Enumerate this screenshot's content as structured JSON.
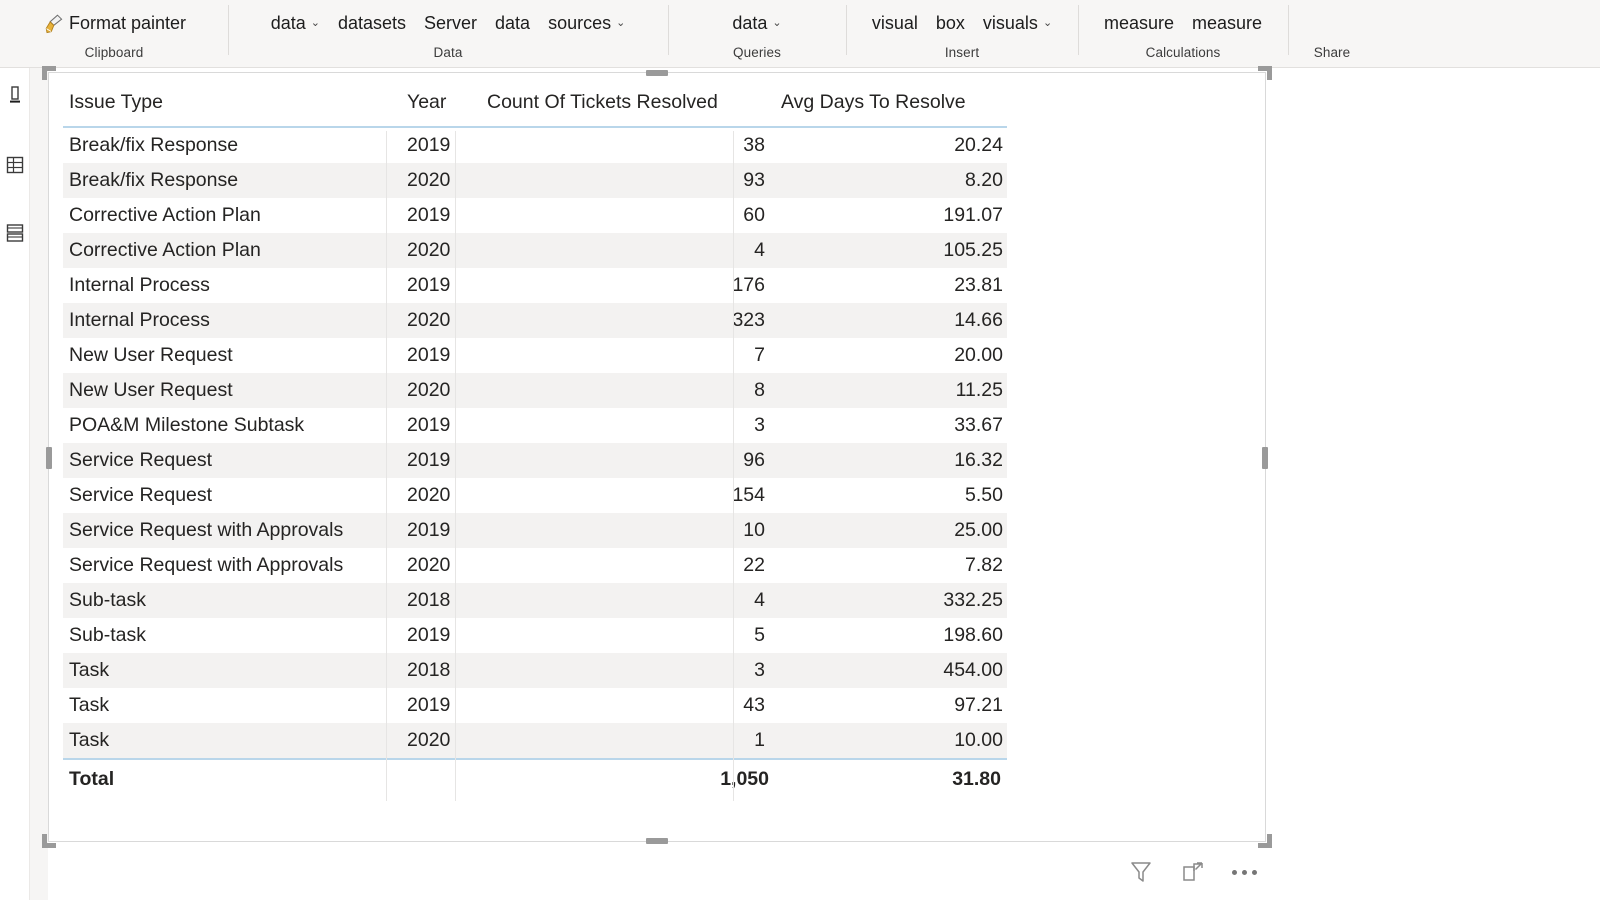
{
  "ribbon": {
    "groups": [
      {
        "name": "clipboard",
        "label": "Clipboard",
        "items": [
          {
            "label": "Format painter",
            "icon": "format-painter-icon",
            "caret": false
          }
        ]
      },
      {
        "name": "data",
        "label": "Data",
        "items": [
          {
            "label": "data",
            "icon": "",
            "caret": true
          },
          {
            "label": "datasets",
            "icon": "",
            "caret": false
          },
          {
            "label": "Server",
            "icon": "",
            "caret": false
          },
          {
            "label": "data",
            "icon": "",
            "caret": false
          },
          {
            "label": "sources",
            "icon": "",
            "caret": true
          }
        ]
      },
      {
        "name": "queries",
        "label": "Queries",
        "items": [
          {
            "label": "data",
            "icon": "",
            "caret": true
          }
        ]
      },
      {
        "name": "insert",
        "label": "Insert",
        "items": [
          {
            "label": "visual",
            "icon": "",
            "caret": false
          },
          {
            "label": "box",
            "icon": "",
            "caret": false
          },
          {
            "label": "visuals",
            "icon": "",
            "caret": true
          }
        ]
      },
      {
        "name": "calculations",
        "label": "Calculations",
        "items": [
          {
            "label": "measure",
            "icon": "",
            "caret": false
          },
          {
            "label": "measure",
            "icon": "",
            "caret": false
          }
        ]
      },
      {
        "name": "share",
        "label": "Share",
        "items": []
      }
    ]
  },
  "left_rail": {
    "items": [
      {
        "name": "report-view-icon"
      },
      {
        "name": "data-view-icon"
      },
      {
        "name": "model-view-icon"
      }
    ]
  },
  "visual_footer": {
    "filter_icon": "filter-icon",
    "focus_icon": "focus-mode-icon",
    "more_label": "more-options-icon"
  },
  "table": {
    "columns": [
      {
        "key": "issue_type",
        "label": "Issue Type",
        "align": "left"
      },
      {
        "key": "year",
        "label": "Year",
        "align": "left"
      },
      {
        "key": "count_resolved",
        "label": "Count Of Tickets Resolved",
        "align": "right"
      },
      {
        "key": "avg_days",
        "label": "Avg Days To Resolve",
        "align": "right"
      }
    ],
    "rows": [
      {
        "issue_type": "Break/fix Response",
        "year": "2019",
        "count_resolved": "38",
        "avg_days": "20.24"
      },
      {
        "issue_type": "Break/fix Response",
        "year": "2020",
        "count_resolved": "93",
        "avg_days": "8.20"
      },
      {
        "issue_type": "Corrective Action Plan",
        "year": "2019",
        "count_resolved": "60",
        "avg_days": "191.07"
      },
      {
        "issue_type": "Corrective Action Plan",
        "year": "2020",
        "count_resolved": "4",
        "avg_days": "105.25"
      },
      {
        "issue_type": "Internal Process",
        "year": "2019",
        "count_resolved": "176",
        "avg_days": "23.81"
      },
      {
        "issue_type": "Internal Process",
        "year": "2020",
        "count_resolved": "323",
        "avg_days": "14.66"
      },
      {
        "issue_type": "New User Request",
        "year": "2019",
        "count_resolved": "7",
        "avg_days": "20.00"
      },
      {
        "issue_type": "New User Request",
        "year": "2020",
        "count_resolved": "8",
        "avg_days": "11.25"
      },
      {
        "issue_type": "POA&M Milestone Subtask",
        "year": "2019",
        "count_resolved": "3",
        "avg_days": "33.67"
      },
      {
        "issue_type": "Service Request",
        "year": "2019",
        "count_resolved": "96",
        "avg_days": "16.32"
      },
      {
        "issue_type": "Service Request",
        "year": "2020",
        "count_resolved": "154",
        "avg_days": "5.50"
      },
      {
        "issue_type": "Service Request with Approvals",
        "year": "2019",
        "count_resolved": "10",
        "avg_days": "25.00"
      },
      {
        "issue_type": "Service Request with Approvals",
        "year": "2020",
        "count_resolved": "22",
        "avg_days": "7.82"
      },
      {
        "issue_type": "Sub-task",
        "year": "2018",
        "count_resolved": "4",
        "avg_days": "332.25"
      },
      {
        "issue_type": "Sub-task",
        "year": "2019",
        "count_resolved": "5",
        "avg_days": "198.60"
      },
      {
        "issue_type": "Task",
        "year": "2018",
        "count_resolved": "3",
        "avg_days": "454.00"
      },
      {
        "issue_type": "Task",
        "year": "2019",
        "count_resolved": "43",
        "avg_days": "97.21"
      },
      {
        "issue_type": "Task",
        "year": "2020",
        "count_resolved": "1",
        "avg_days": "10.00"
      }
    ],
    "total": {
      "issue_type": "Total",
      "year": "",
      "count_resolved": "1,050",
      "avg_days": "31.80"
    }
  },
  "colors": {
    "ribbon_bg": "#f7f6f5",
    "header_rule": "#b9d6ea",
    "alt_row": "#f3f2f1",
    "text": "#252423",
    "brush_gold": "#e8b23a",
    "handle": "#9a9a9a"
  }
}
